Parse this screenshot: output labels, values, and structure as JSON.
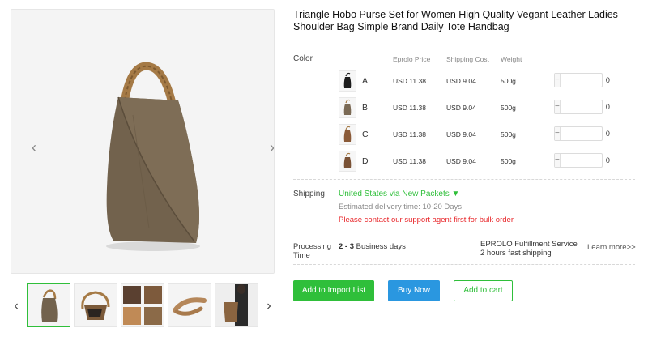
{
  "product": {
    "title": "Triangle Hobo Purse Set for Women High Quality Vegant Leather Ladies Shoulder Bag Simple Brand Daily Tote Handbag"
  },
  "gallery": {
    "prev_icon": "chevron-left-icon",
    "next_icon": "chevron-right-icon",
    "prev_glyph": "‹",
    "next_glyph": "›"
  },
  "variants": {
    "color_label": "Color",
    "headers": {
      "price": "Eprolo Price",
      "shipping_cost": "Shipping Cost",
      "weight": "Weight"
    },
    "rows": [
      {
        "letter": "A",
        "price": "USD 11.38",
        "shipping": "USD 9.04",
        "weight": "500g",
        "qty": "0",
        "swatch": "#1c1c1c"
      },
      {
        "letter": "B",
        "price": "USD 11.38",
        "shipping": "USD 9.04",
        "weight": "500g",
        "qty": "0",
        "swatch": "#7b6a55"
      },
      {
        "letter": "C",
        "price": "USD 11.38",
        "shipping": "USD 9.04",
        "weight": "500g",
        "qty": "0",
        "swatch": "#8a5a38"
      },
      {
        "letter": "D",
        "price": "USD 11.38",
        "shipping": "USD 9.04",
        "weight": "500g",
        "qty": "0",
        "swatch": "#7a5236"
      }
    ],
    "minus": "−",
    "plus": "+"
  },
  "shipping": {
    "label": "Shipping",
    "method": "United States via New Packets ▼",
    "estimate": "Estimated delivery time: 10-20 Days",
    "warning": "Please contact our support agent first for bulk order"
  },
  "processing": {
    "label": "Processing Time",
    "days_bold": "2 - 3",
    "days_rest": " Business days",
    "service_line1": "EPROLO Fulfillment Service",
    "service_line2": "2 hours fast shipping",
    "learn_more": "Learn more>>"
  },
  "actions": {
    "import": "Add to Import List",
    "buy": "Buy Now",
    "cart": "Add to cart"
  },
  "colors": {
    "green": "#2fbf3a",
    "blue": "#2a97e0",
    "red": "#e8262a"
  }
}
